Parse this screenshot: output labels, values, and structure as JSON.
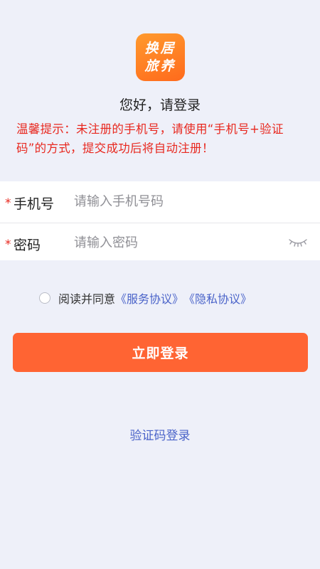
{
  "logo": {
    "line1": "换居",
    "line2": "旅养",
    "colors": [
      "#ff9a2e",
      "#ff6a1c"
    ]
  },
  "greeting": "您好，请登录",
  "tip": "温馨提示：未注册的手机号，请使用“手机号+验证码”的方式，提交成功后将自动注册！",
  "form": {
    "phone": {
      "required_mark": "*",
      "label": "手机号",
      "placeholder": "请输入手机号码",
      "value": ""
    },
    "password": {
      "required_mark": "*",
      "label": "密码",
      "placeholder": "请输入密码",
      "value": "",
      "toggle_icon": "eye-closed-icon"
    }
  },
  "agreement": {
    "checked": false,
    "text": "阅读并同意",
    "service_link": "《服务协议》",
    "privacy_link": "《隐私协议》"
  },
  "login_button": "立即登录",
  "code_login_link": "验证码登录",
  "colors": {
    "background": "#eef0f9",
    "accent": "#ff6433",
    "tip_red": "#e8281f",
    "link_blue": "#4a63c9"
  }
}
